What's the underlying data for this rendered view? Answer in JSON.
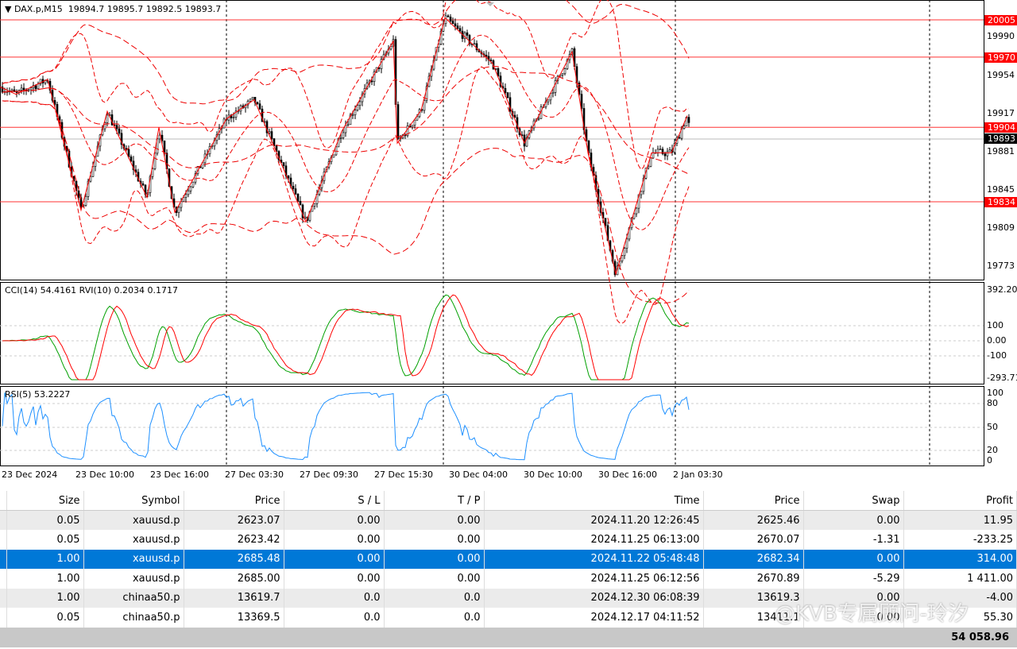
{
  "header": {
    "symbol": "DAX.p,M15",
    "open": "19894.7",
    "high": "19895.7",
    "low": "19892.5",
    "close": "19893.7"
  },
  "price_axis": [
    "19990",
    "19954",
    "19917",
    "19881",
    "19845",
    "19809",
    "19773"
  ],
  "level_tags": [
    {
      "value": "20005",
      "color": "#ff0000"
    },
    {
      "value": "19970",
      "color": "#ff0000"
    },
    {
      "value": "19904",
      "color": "#ff0000"
    },
    {
      "value": "19893",
      "color": "#000000"
    },
    {
      "value": "19834",
      "color": "#ff0000"
    }
  ],
  "cci_panel": {
    "label": "CCI(14) 54.4161  RVI(10) 0.2034 0.1717",
    "axis": [
      "392.20",
      "100",
      "0.00",
      "-100",
      "-293.71"
    ]
  },
  "rsi_panel": {
    "label": "RSI(5) 53.2227",
    "axis": [
      "100",
      "80",
      "50",
      "20",
      "0"
    ]
  },
  "time_axis": [
    "23 Dec 2024",
    "23 Dec 10:00",
    "23 Dec 16:00",
    "27 Dec 03:30",
    "27 Dec 09:30",
    "27 Dec 15:30",
    "30 Dec 04:00",
    "30 Dec 10:00",
    "30 Dec 16:00",
    "2 Jan 03:30"
  ],
  "price_path": [
    [
      0,
      19942
    ],
    [
      20,
      19935
    ],
    [
      60,
      19949
    ],
    [
      102,
      19826
    ],
    [
      135,
      19919
    ],
    [
      185,
      19838
    ],
    [
      200,
      19904
    ],
    [
      220,
      19824
    ],
    [
      285,
      19912
    ],
    [
      320,
      19930
    ],
    [
      385,
      19815
    ],
    [
      430,
      19900
    ],
    [
      495,
      19985
    ],
    [
      500,
      19889
    ],
    [
      530,
      19920
    ],
    [
      560,
      20007
    ],
    [
      620,
      19964
    ],
    [
      660,
      19889
    ],
    [
      720,
      19975
    ],
    [
      740,
      19880
    ],
    [
      775,
      19766
    ],
    [
      820,
      19880
    ],
    [
      845,
      19880
    ],
    [
      865,
      19915
    ],
    [
      870,
      19893
    ]
  ],
  "colors": {
    "bull": "#000000",
    "bear": "#000000",
    "levels": "#ff0000",
    "cci": "#00a000",
    "rvi": "#ff0000",
    "rsi": "#1e90ff",
    "selected_row": "#0078d7"
  },
  "table": {
    "headers": [
      "",
      "Size",
      "Symbol",
      "Price",
      "S / L",
      "T / P",
      "Time",
      "Price",
      "Swap",
      "Profit"
    ],
    "rows": [
      [
        "0.05",
        "xauusd.p",
        "2623.07",
        "0.00",
        "0.00",
        "2024.11.20 12:26:45",
        "2625.46",
        "0.00",
        "11.95"
      ],
      [
        "0.05",
        "xauusd.p",
        "2623.42",
        "0.00",
        "0.00",
        "2024.11.25 06:13:00",
        "2670.07",
        "-1.31",
        "-233.25"
      ],
      [
        "1.00",
        "xauusd.p",
        "2685.48",
        "0.00",
        "0.00",
        "2024.11.22 05:48:48",
        "2682.34",
        "0.00",
        "314.00"
      ],
      [
        "1.00",
        "xauusd.p",
        "2685.00",
        "0.00",
        "0.00",
        "2024.11.25 06:12:56",
        "2670.89",
        "-5.29",
        "1 411.00"
      ],
      [
        "1.00",
        "chinaa50.p",
        "13619.7",
        "0.0",
        "0.0",
        "2024.12.30 06:08:39",
        "13619.3",
        "0.00",
        "-4.00"
      ],
      [
        "0.05",
        "chinaa50.p",
        "13369.5",
        "0.0",
        "0.0",
        "2024.12.17 04:11:52",
        "13411.1",
        "0.00",
        "55.30"
      ]
    ],
    "selected_index": 2,
    "total": "54 058.96"
  },
  "watermark": "@KVB专属顾问-玲汐"
}
